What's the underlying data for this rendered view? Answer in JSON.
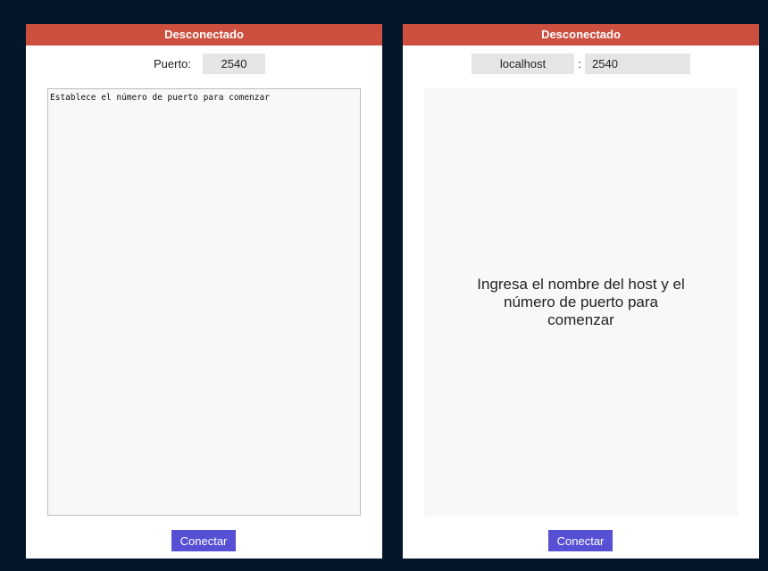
{
  "colors": {
    "background": "#03162a",
    "status_disconnected": "#cc4f3f",
    "button": "#5750d4",
    "input_bg": "#e5e5e5"
  },
  "server": {
    "status": "Desconectado",
    "port_label": "Puerto:",
    "port_value": "2540",
    "log_text": "Establece el número de puerto para comenzar",
    "connect_label": "Conectar"
  },
  "client": {
    "status": "Desconectado",
    "host_value": "localhost",
    "separator": ":",
    "port_value": "2540",
    "message": "Ingresa el nombre del host y el número de puerto para comenzar",
    "connect_label": "Conectar"
  }
}
